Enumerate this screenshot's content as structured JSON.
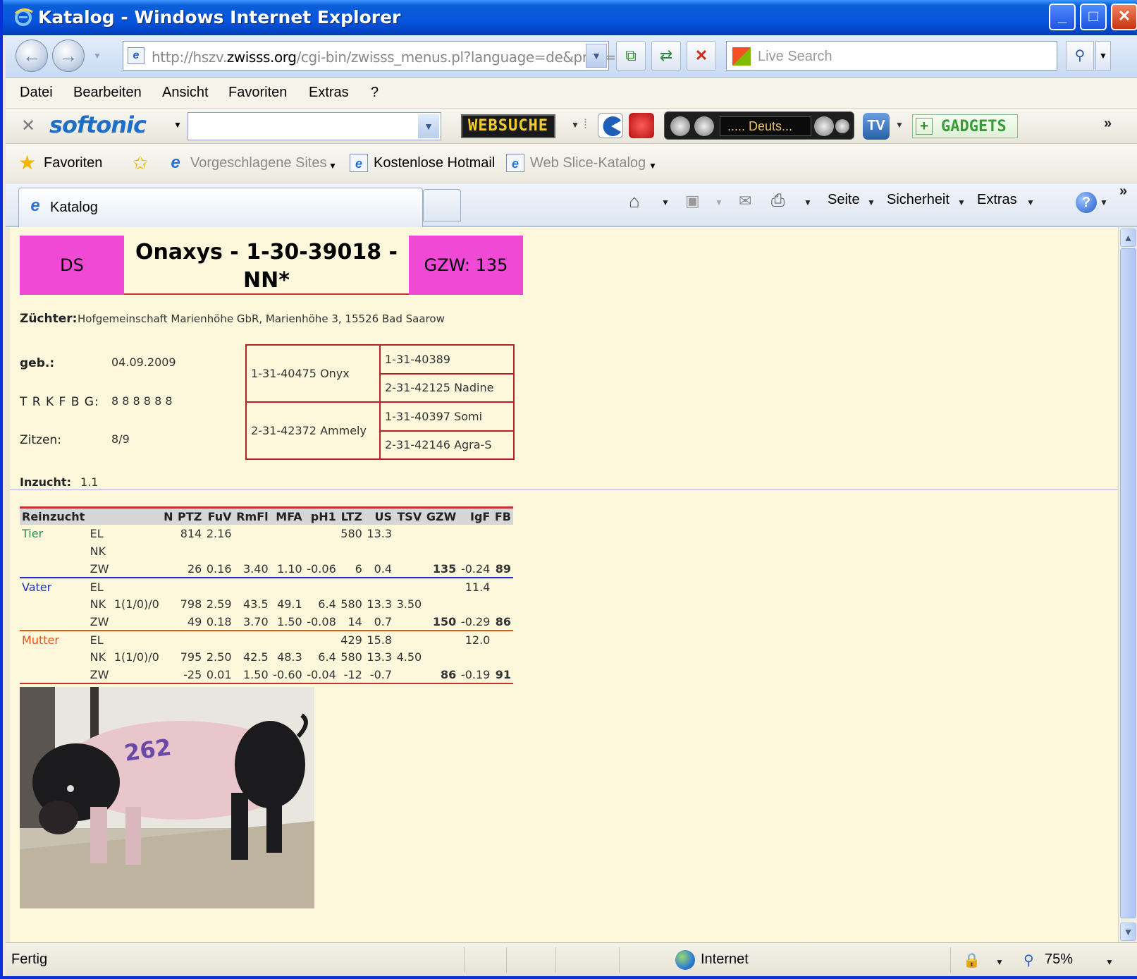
{
  "window": {
    "title": "Katalog - Windows Internet Explorer"
  },
  "address": {
    "url_prefix": "http://hszv.",
    "url_domain": "zwisss.org",
    "url_suffix": "/cgi-bin/zwisss_menus.pl?language=de&prog="
  },
  "search": {
    "placeholder": "Live Search"
  },
  "menu": {
    "items": [
      "Datei",
      "Bearbeiten",
      "Ansicht",
      "Favoriten",
      "Extras",
      "?"
    ]
  },
  "softonic": {
    "brand": "softonic",
    "websuche": "WEBSUCHE",
    "radio_station": "..... Deuts...",
    "tv": "TV",
    "gadgets": "GADGETS"
  },
  "favorites": {
    "favoriten": "Favoriten",
    "suggested": "Vorgeschlagene Sites",
    "hotmail": "Kostenlose Hotmail",
    "webslice": "Web Slice-Katalog"
  },
  "tab": {
    "title": "Katalog"
  },
  "commandbar": {
    "seite": "Seite",
    "sicherheit": "Sicherheit",
    "extras": "Extras"
  },
  "animal": {
    "category": "DS",
    "name": "Onaxys - 1-30-39018 - NN*",
    "gzw": "GZW: 135",
    "breeder_label": "Züchter:",
    "breeder": "Hofgemeinschaft Marienhöhe GbR, Marienhöhe 3, 15526 Bad Saarow",
    "born_label": "geb.:",
    "born": "04.09.2009",
    "trkfbg_label": "T R K F B G:",
    "trkfbg": "8 8 8 8 8 8",
    "teats_label": "Zitzen:",
    "teats": "8/9",
    "inbreeding_label": "Inzucht:",
    "inbreeding": "1.1"
  },
  "pedigree": {
    "sire": "1-31-40475 Onyx",
    "dam": "2-31-42372 Ammely",
    "sire_sire": "1-31-40389",
    "sire_dam": "2-31-42125 Nadine",
    "dam_sire": "1-31-40397 Somi",
    "dam_dam": "2-31-42146 Agra-S"
  },
  "performance": {
    "headers": [
      "Reinzucht",
      "",
      "",
      "N",
      "PTZ",
      "FuV",
      "RmFl",
      "MFA",
      "pH1",
      "LTZ",
      "US",
      "TSV",
      "GZW",
      "IgF",
      "FB"
    ],
    "rows": [
      {
        "role": "Tier",
        "type": "EL",
        "c": [
          "",
          "",
          "814",
          "2.16",
          "",
          "",
          "",
          "580",
          "13.3",
          "",
          "",
          "",
          ""
        ]
      },
      {
        "role": "",
        "type": "NK",
        "c": [
          "",
          "",
          "",
          "",
          "",
          "",
          "",
          "",
          "",
          "",
          "",
          "",
          ""
        ]
      },
      {
        "role": "",
        "type": "ZW",
        "c": [
          "",
          "",
          "26",
          "0.16",
          "3.40",
          "1.10",
          "-0.06",
          "6",
          "0.4",
          "",
          "135",
          "-0.24",
          "89"
        ]
      },
      {
        "role": "Vater",
        "type": "EL",
        "c": [
          "",
          "",
          "",
          "",
          "",
          "",
          "",
          "",
          "",
          "",
          "",
          "11.4",
          ""
        ]
      },
      {
        "role": "",
        "type": "NK",
        "c": [
          "1(1/0)/0",
          "",
          "798",
          "2.59",
          "43.5",
          "49.1",
          "6.4",
          "580",
          "13.3",
          "3.50",
          "",
          "",
          ""
        ]
      },
      {
        "role": "",
        "type": "ZW",
        "c": [
          "",
          "",
          "49",
          "0.18",
          "3.70",
          "1.50",
          "-0.08",
          "14",
          "0.7",
          "",
          "150",
          "-0.29",
          "86"
        ]
      },
      {
        "role": "Mutter",
        "type": "EL",
        "c": [
          "",
          "",
          "",
          "",
          "",
          "",
          "",
          "429",
          "15.8",
          "",
          "",
          "12.0",
          ""
        ]
      },
      {
        "role": "",
        "type": "NK",
        "c": [
          "1(1/0)/0",
          "",
          "795",
          "2.50",
          "42.5",
          "48.3",
          "6.4",
          "580",
          "13.3",
          "4.50",
          "",
          "",
          ""
        ]
      },
      {
        "role": "",
        "type": "ZW",
        "c": [
          "",
          "",
          "-25",
          "0.01",
          "1.50",
          "-0.60",
          "-0.04",
          "-12",
          "-0.7",
          "",
          "86",
          "-0.19",
          "91"
        ]
      }
    ],
    "colors": {
      "Tier": "#2e8b57",
      "Vater": "#1f2fbf",
      "Mutter": "#e8501c"
    }
  },
  "photo": {
    "marking": "262"
  },
  "status": {
    "left": "Fertig",
    "zone": "Internet",
    "zoom": "75%"
  }
}
